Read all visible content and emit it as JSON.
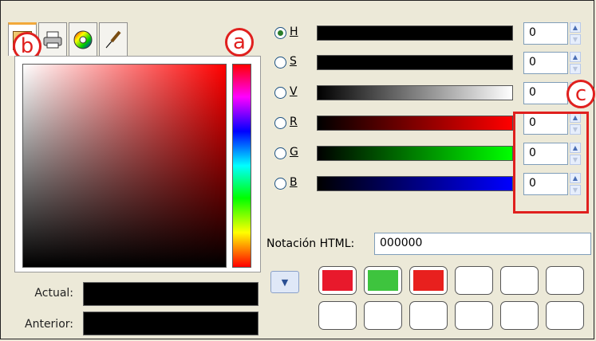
{
  "tabs": [
    {
      "icon": "scales-icon",
      "active": true
    },
    {
      "icon": "printer-icon"
    },
    {
      "icon": "color-wheel-icon"
    },
    {
      "icon": "brush-icon"
    }
  ],
  "markers": {
    "a": "a",
    "b": "b",
    "c": "c"
  },
  "channels": [
    {
      "key": "H",
      "label": "H",
      "value": "0",
      "selected": true
    },
    {
      "key": "S",
      "label": "S",
      "value": "0"
    },
    {
      "key": "V",
      "label": "V",
      "value": "0"
    },
    {
      "key": "R",
      "label": "R",
      "value": "0"
    },
    {
      "key": "G",
      "label": "G",
      "value": "0"
    },
    {
      "key": "B",
      "label": "B",
      "value": "0"
    }
  ],
  "html_notation": {
    "label": "Notación HTML:",
    "value": "000000"
  },
  "swatches": {
    "current_label": "Actual:",
    "previous_label": "Anterior:",
    "current_color": "#000000",
    "previous_color": "#000000"
  },
  "history": {
    "row1": [
      "#e8192c",
      "#3ec43e",
      "#e8201e",
      "#ffffff",
      "#ffffff",
      "#ffffff"
    ],
    "row2": [
      "#ffffff",
      "#ffffff",
      "#ffffff",
      "#ffffff",
      "#ffffff",
      "#ffffff"
    ]
  },
  "colors": {
    "highlight": "#e0201e",
    "radio_dot": "#2a7d2a",
    "tab_accent": "#f2a93b"
  }
}
